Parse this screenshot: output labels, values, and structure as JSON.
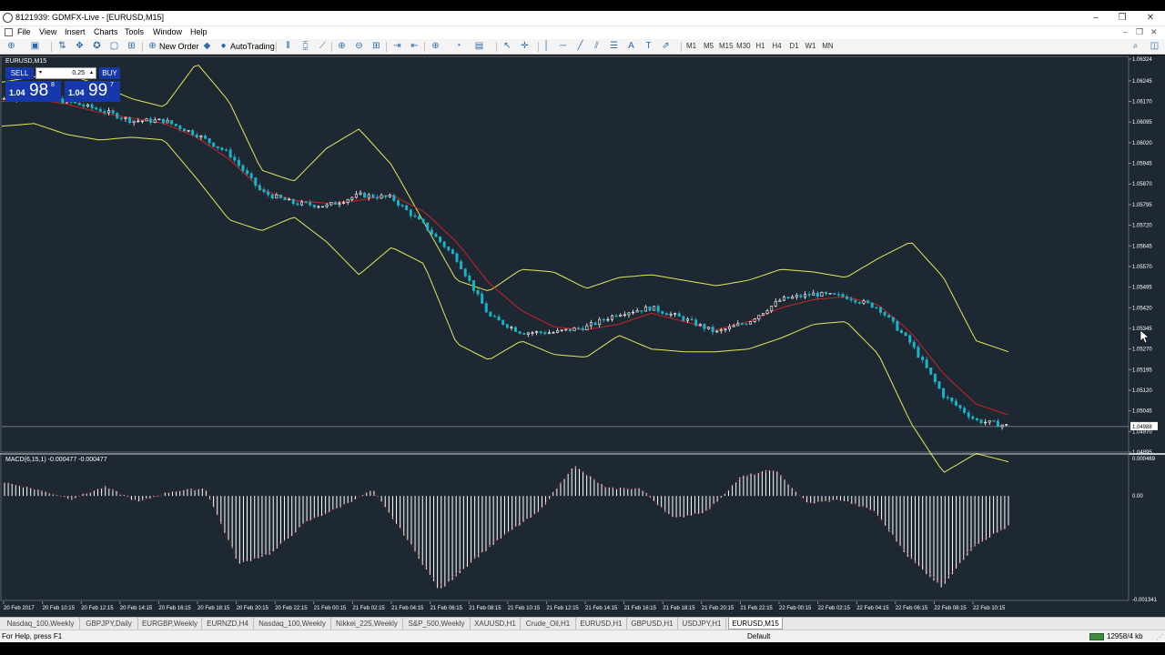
{
  "window": {
    "title": "8121939: GDMFX-Live - [EURUSD,M15]",
    "controls": [
      "–",
      "❐",
      "✕"
    ]
  },
  "menu": {
    "items": [
      "File",
      "View",
      "Insert",
      "Charts",
      "Tools",
      "Window",
      "Help"
    ],
    "right": [
      "–",
      "❐",
      "✕"
    ]
  },
  "toolbar": {
    "new_order": "New Order",
    "autotrading": "AutoTrading",
    "timeframes": [
      "M1",
      "M5",
      "M15",
      "M30",
      "H1",
      "H4",
      "D1",
      "W1",
      "MN"
    ]
  },
  "chart": {
    "label": "EURUSD,M15",
    "trade_panel": {
      "sell_label": "SELL",
      "buy_label": "BUY",
      "lot": "0.25",
      "sell_prefix": "1.04",
      "sell_big": "98",
      "sell_sup": "8",
      "buy_prefix": "1.04",
      "buy_big": "99",
      "buy_sup": "7"
    },
    "macd_title": "MACD(6,15,1) -0.000477 -0.000477",
    "price_labels": [
      "1.06324",
      "1.06245",
      "1.06170",
      "1.06095",
      "1.06020",
      "1.05945",
      "1.05870",
      "1.05795",
      "1.05720",
      "1.05645",
      "1.05570",
      "1.05495",
      "1.05420",
      "1.05345",
      "1.05270",
      "1.05195",
      "1.05120",
      "1.05045",
      "1.04988",
      "1.04970",
      "1.04895"
    ],
    "current_price": "1.04988",
    "macd_labels": [
      "0.000469",
      "0.00",
      "-0.001341"
    ],
    "time_labels": [
      "20 Feb 2017",
      "20 Feb 10:15",
      "20 Feb 12:15",
      "20 Feb 14:15",
      "20 Feb 16:15",
      "20 Feb 18:15",
      "20 Feb 20:15",
      "20 Feb 22:15",
      "21 Feb 00:15",
      "21 Feb 02:15",
      "21 Feb 04:15",
      "21 Feb 06:15",
      "21 Feb 08:15",
      "21 Feb 10:15",
      "21 Feb 12:15",
      "21 Feb 14:15",
      "21 Feb 16:15",
      "21 Feb 18:15",
      "21 Feb 20:15",
      "21 Feb 22:15",
      "22 Feb 00:15",
      "22 Feb 02:15",
      "22 Feb 04:15",
      "22 Feb 06:15",
      "22 Feb 08:15",
      "22 Feb 10:15"
    ],
    "colors": {
      "background": "#1e2832",
      "bands": "#e6e65a",
      "middle_band": "#cc2222",
      "bull_candle": "#ffffff",
      "bear_candle": "#19b4c8",
      "macd": "#ffffff"
    }
  },
  "chart_data": {
    "type": "candlestick",
    "symbol": "EURUSD",
    "timeframe": "M15",
    "indicators": [
      "Bollinger Bands",
      "MACD(6,15,1)"
    ],
    "ylim": [
      1.04895,
      1.06324
    ],
    "bollinger_mid_path": [
      1.0617,
      1.0618,
      1.0616,
      1.0613,
      1.0611,
      1.0609,
      1.0604,
      1.0596,
      1.0585,
      1.0581,
      1.058,
      1.0581,
      1.0583,
      1.0577,
      1.0566,
      1.0551,
      1.0541,
      1.0535,
      1.0534,
      1.0536,
      1.054,
      1.0537,
      1.0534,
      1.0537,
      1.0542,
      1.0545,
      1.0546,
      1.0543,
      1.0533,
      1.0518,
      1.0507,
      1.0503
    ],
    "bollinger_upper_path": [
      1.0624,
      1.0626,
      1.0627,
      1.0623,
      1.0618,
      1.0615,
      1.0631,
      1.0617,
      1.0592,
      1.0588,
      1.06,
      1.0607,
      1.0594,
      1.0573,
      1.0552,
      1.0548,
      1.0556,
      1.0555,
      1.0549,
      1.0553,
      1.0554,
      1.0552,
      1.055,
      1.0552,
      1.0556,
      1.0555,
      1.0553,
      1.056,
      1.0566,
      1.0553,
      1.053,
      1.0526
    ],
    "bollinger_lower_path": [
      1.0608,
      1.0609,
      1.0605,
      1.0603,
      1.0604,
      1.0603,
      1.0589,
      1.0574,
      1.057,
      1.0575,
      1.0566,
      1.0554,
      1.0564,
      1.0558,
      1.0529,
      1.0523,
      1.053,
      1.0525,
      1.0524,
      1.0532,
      1.0527,
      1.0526,
      1.0526,
      1.0527,
      1.0531,
      1.0536,
      1.0537,
      1.0525,
      1.05,
      1.0482,
      1.0489,
      1.0486
    ],
    "close_path": [
      1.0618,
      1.0619,
      1.0617,
      1.0614,
      1.061,
      1.061,
      1.0605,
      1.0598,
      1.0584,
      1.058,
      1.0579,
      1.0583,
      1.0582,
      1.0572,
      1.056,
      1.0539,
      1.0533,
      1.0533,
      1.0535,
      1.054,
      1.0542,
      1.0538,
      1.0533,
      1.0537,
      1.0545,
      1.0547,
      1.0546,
      1.0542,
      1.0529,
      1.051,
      1.0501,
      1.0499
    ],
    "macd_path": [
      0.00018,
      8e-05,
      -4e-05,
      0.00012,
      -8e-05,
      6e-05,
      0.0001,
      -0.0009,
      -0.00075,
      -0.00035,
      -0.00015,
      8e-05,
      -0.00055,
      -0.00125,
      -0.00085,
      -0.0005,
      -0.0002,
      0.0004,
      0.0001,
      0.0001,
      -0.0003,
      -0.0002,
      0.00025,
      0.00035,
      -0.0001,
      -5e-05,
      -0.0002,
      -0.0008,
      -0.0012,
      -0.00065,
      -0.0004
    ]
  },
  "tabs": [
    "Nasdaq_100,Weekly",
    "GBPJPY,Daily",
    "EURGBP,Weekly",
    "EURNZD,H4",
    "Nasdaq_100,Weekly",
    "Nikkei_225,Weekly",
    "S&P_500,Weekly",
    "XAUUSD,H1",
    "Crude_Oil,H1",
    "EURUSD,H1",
    "GBPUSD,H1",
    "USDJPY,H1",
    "EURUSD,M15"
  ],
  "status": {
    "help": "For Help, press F1",
    "profile": "Default",
    "connection": "12958/4 kb"
  }
}
